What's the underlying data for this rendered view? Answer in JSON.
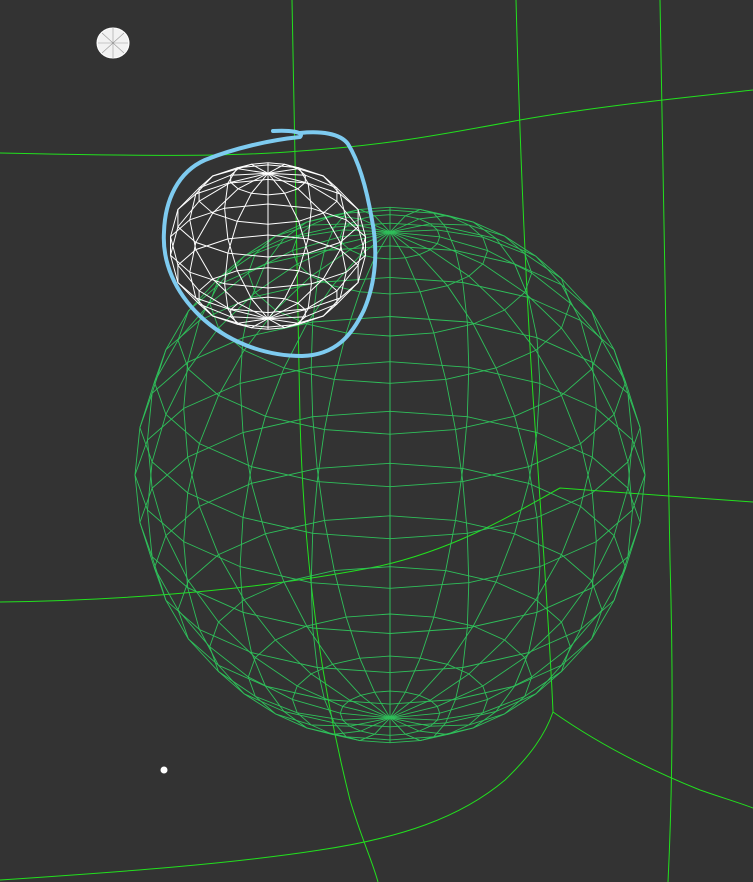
{
  "viewport": {
    "background_color": "#333333"
  },
  "colors": {
    "guide_lines": "#22e01e",
    "large_mesh": "#2fbf5a",
    "small_mesh": "#ffffff",
    "selection_circle": "#7ecbf0",
    "marker": "#ffffff"
  },
  "objects": {
    "large_mesh": {
      "kind": "wireframe-sphere",
      "rings": 16,
      "segments": 20
    },
    "small_mesh": {
      "kind": "wireframe-sphere",
      "rings": 8,
      "segments": 14
    },
    "selection_annotation": {
      "kind": "freehand-circle"
    }
  },
  "icons": {
    "sphere_marker": "small-white-sphere-icon",
    "point_marker": "white-dot-icon"
  }
}
